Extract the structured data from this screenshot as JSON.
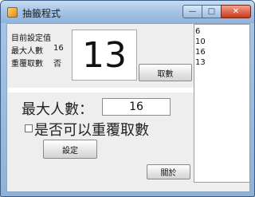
{
  "window": {
    "title": "抽籤程式",
    "min_glyph": "—",
    "max_glyph": "□",
    "close_glyph": "✕"
  },
  "status": {
    "heading": "目前設定值",
    "max_label": "最大人數",
    "max_value": "16",
    "repeat_label": "重覆取數",
    "repeat_value": "否"
  },
  "display": {
    "current_number": "13"
  },
  "buttons": {
    "draw": "取數",
    "set": "設定",
    "about": "關於"
  },
  "settings": {
    "max_label": "最大人數：",
    "max_value": "16",
    "repeat_label": "是否可以重覆取數",
    "repeat_checked": false
  },
  "history": [
    "6",
    "10",
    "16",
    "13"
  ]
}
